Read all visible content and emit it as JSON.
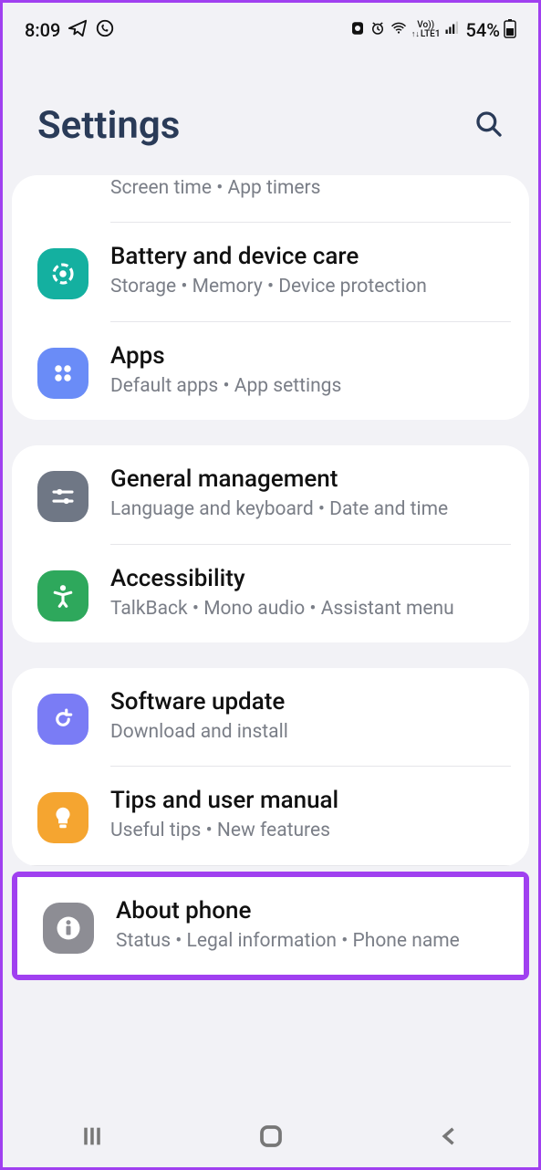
{
  "status": {
    "time": "8:09",
    "lte": "LTE1",
    "vo": "Vo))",
    "battery_pct": "54%"
  },
  "header": {
    "title": "Settings"
  },
  "groups": [
    {
      "items": [
        {
          "title": "",
          "subtitle": "Screen time  •  App timers"
        },
        {
          "title": "Battery and device care",
          "subtitle": "Storage  •  Memory  •  Device protection",
          "color": "#14b0a0"
        },
        {
          "title": "Apps",
          "subtitle": "Default apps  •  App settings",
          "color": "#6a8cf7"
        }
      ]
    },
    {
      "items": [
        {
          "title": "General management",
          "subtitle": "Language and keyboard  •  Date and time",
          "color": "#6f7785"
        },
        {
          "title": "Accessibility",
          "subtitle": "TalkBack  •  Mono audio  •  Assistant menu",
          "color": "#2ea85c"
        }
      ]
    },
    {
      "items": [
        {
          "title": "Software update",
          "subtitle": "Download and install",
          "color": "#7a7cf5"
        },
        {
          "title": "Tips and user manual",
          "subtitle": "Useful tips  •  New features",
          "color": "#f5a530"
        },
        {
          "title": "About phone",
          "subtitle": "Status  •  Legal information  •  Phone name",
          "color": "#8d8d94"
        }
      ]
    }
  ]
}
